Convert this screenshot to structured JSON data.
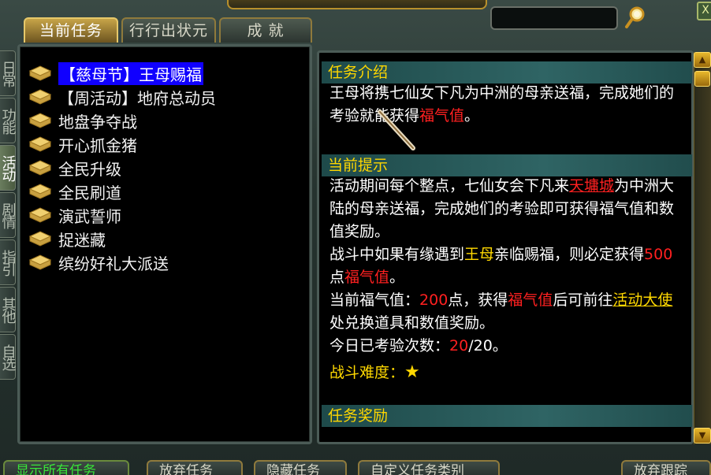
{
  "tabs": [
    {
      "label": "当前任务",
      "active": true
    },
    {
      "label": "行行出状元",
      "active": false
    },
    {
      "label": "成 就",
      "active": false
    }
  ],
  "search": {
    "value": "",
    "placeholder": ""
  },
  "top_close_label": "X",
  "side_tabs": [
    {
      "label": "日常",
      "active": false
    },
    {
      "label": "功能",
      "active": false
    },
    {
      "label": "活动",
      "active": true
    },
    {
      "label": "剧情",
      "active": false
    },
    {
      "label": "指引",
      "active": false
    },
    {
      "label": "其他",
      "active": false
    },
    {
      "label": "自选",
      "active": false
    }
  ],
  "task_list": [
    {
      "label": "【慈母节】王母赐福",
      "selected": true
    },
    {
      "label": "【周活动】地府总动员",
      "selected": false
    },
    {
      "label": "地盘争夺战",
      "selected": false
    },
    {
      "label": "开心抓金猪",
      "selected": false
    },
    {
      "label": "全民升级",
      "selected": false
    },
    {
      "label": "全民刷道",
      "selected": false
    },
    {
      "label": "演武誓师",
      "selected": false
    },
    {
      "label": "捉迷藏",
      "selected": false
    },
    {
      "label": "缤纷好礼大派送",
      "selected": false
    }
  ],
  "detail": {
    "intro_header": "任务介绍",
    "intro_text_1": "王母将携七仙女下凡为中洲的母亲送福，完成她们的考验就能获得",
    "intro_red": "福气值",
    "intro_end": "。",
    "hint_header": "当前提示",
    "hint_1a": "活动期间每个整点，七仙女会下凡来",
    "hint_1_link": "天墉城",
    "hint_1b": "为中洲大陆的母亲送福，完成她们的考验即可获得福气值和数值奖励。",
    "hint_2a": "战斗中如果有缘遇到",
    "hint_2_yellow": "王母",
    "hint_2b": "亲临赐福，则必定获得",
    "hint_2_num": "500",
    "hint_2c": "点",
    "hint_2_red": "福气值",
    "hint_2d": "。",
    "hint_3a": "当前福气值：",
    "hint_3_num": "200",
    "hint_3b": "点，获得",
    "hint_3_red": "福气值",
    "hint_3c": "后可前往",
    "hint_3_link": "活动大使",
    "hint_3d": "处兑换道具和数值奖励。",
    "hint_4a": "今日已考验次数：",
    "hint_4_num": "20",
    "hint_4b": "/20。",
    "difficulty_label": "战斗难度：",
    "difficulty_star": "★",
    "reward_header": "任务奖励"
  },
  "bottom_buttons": [
    {
      "label": "显示所有任务",
      "green": true
    },
    {
      "label": "放弃任务",
      "green": false
    },
    {
      "label": "隐藏任务",
      "green": false
    },
    {
      "label": "自定义任务类别",
      "green": false
    },
    {
      "label": "放弃跟踪",
      "green": false
    }
  ],
  "colors": {
    "accent_gold": "#ffd700",
    "highlight_red": "#ff2020",
    "selection_blue": "#1000ff",
    "active_green": "#39e639"
  }
}
